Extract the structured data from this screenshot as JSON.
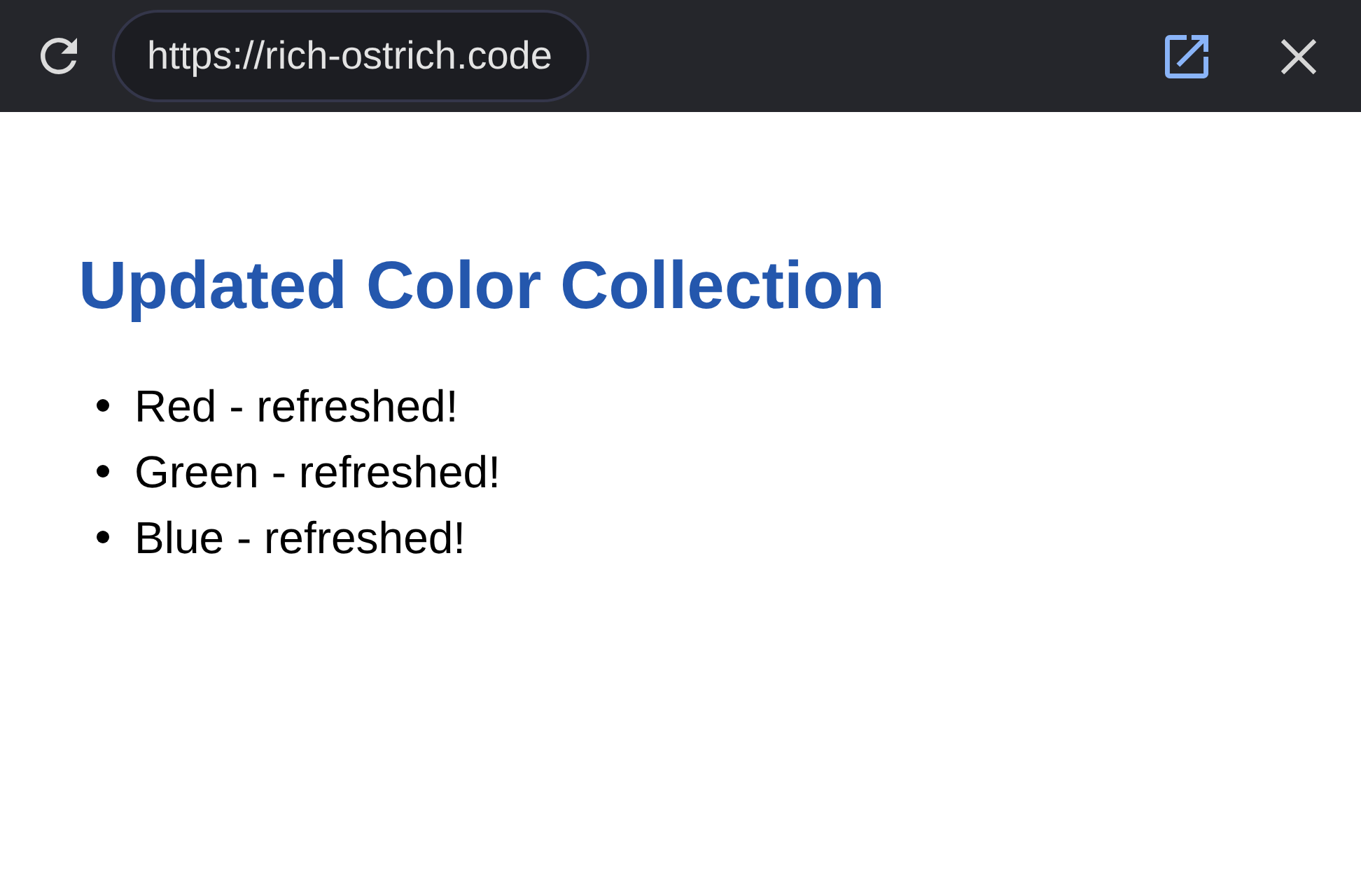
{
  "browser_bar": {
    "url": "https://rich-ostrich.code"
  },
  "page": {
    "heading": "Updated Color Collection",
    "items": [
      "Red - refreshed!",
      "Green - refreshed!",
      "Blue - refreshed!"
    ]
  }
}
